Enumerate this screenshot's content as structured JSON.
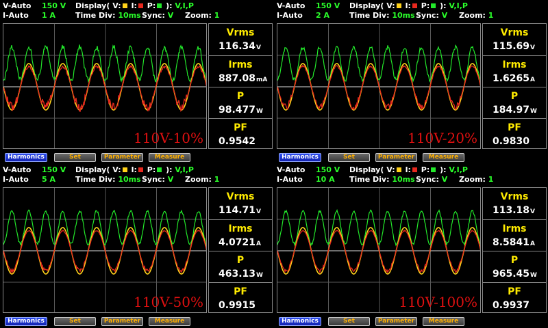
{
  "colors": {
    "voltage": "#ffd21a",
    "current": "#e8281e",
    "power": "#22e82a",
    "text_green": "#2aff2a",
    "label_yellow": "#ffeb00",
    "caption_red": "#e01010"
  },
  "common": {
    "v_auto_label": "V-Auto",
    "i_auto_label": "I-Auto",
    "display_label": "Display( V:",
    "display_i": " I:",
    "display_p": " P:",
    "display_close": " ):",
    "display_value": "V,I,P",
    "time_div_label": "Time  Div:",
    "time_div_value": "10ms",
    "sync_label": "Sync:",
    "sync_value": "V",
    "zoom_label": "Zoom:",
    "zoom_value": "1",
    "meas_labels": [
      "Vrms",
      "Irms",
      "P",
      "PF"
    ],
    "buttons": {
      "harmonics": "Harmonics",
      "set": "Set",
      "parameter": "Parameter",
      "measure": "Measure"
    },
    "display_icons": [
      "voltage-square-icon",
      "current-square-icon",
      "power-square-icon"
    ]
  },
  "panels": [
    {
      "v_range": "150  V",
      "i_range": "1  A",
      "vrms": "116.34",
      "vrms_unit": "V",
      "irms": "887.08",
      "irms_unit": "mA",
      "p": "98.477",
      "p_unit": "W",
      "pf": "0.9542",
      "caption": "110V-10%",
      "current_distortion": "high"
    },
    {
      "v_range": "150  V",
      "i_range": "2  A",
      "vrms": "115.69",
      "vrms_unit": "V",
      "irms": "1.6265",
      "irms_unit": "A",
      "p": "184.97",
      "p_unit": "W",
      "pf": "0.9830",
      "caption": "110V-20%",
      "current_distortion": "medium"
    },
    {
      "v_range": "150  V",
      "i_range": "5  A",
      "vrms": "114.71",
      "vrms_unit": "V",
      "irms": "4.0721",
      "irms_unit": "A",
      "p": "463.13",
      "p_unit": "W",
      "pf": "0.9915",
      "caption": "110V-50%",
      "current_distortion": "low"
    },
    {
      "v_range": "150  V",
      "i_range": "10  A",
      "vrms": "113.18",
      "vrms_unit": "V",
      "irms": "8.5841",
      "irms_unit": "A",
      "p": "965.45",
      "p_unit": "W",
      "pf": "0.9937",
      "caption": "110V-100%",
      "current_distortion": "low"
    }
  ]
}
